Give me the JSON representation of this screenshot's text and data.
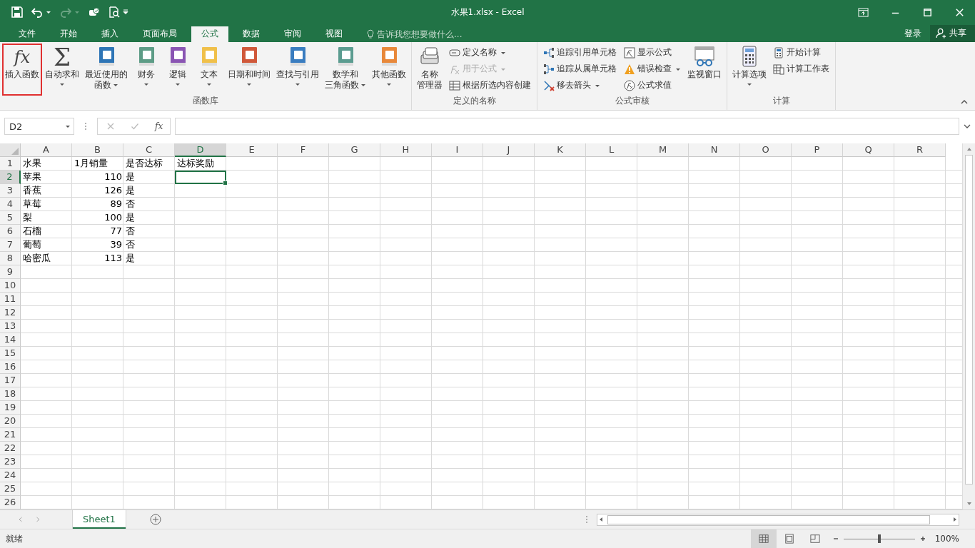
{
  "window": {
    "title": "水果1.xlsx - Excel"
  },
  "tabs": [
    {
      "label": "文件",
      "selected": false
    },
    {
      "label": "开始",
      "selected": false
    },
    {
      "label": "插入",
      "selected": false
    },
    {
      "label": "页面布局",
      "selected": false
    },
    {
      "label": "公式",
      "selected": true
    },
    {
      "label": "数据",
      "selected": false
    },
    {
      "label": "审阅",
      "selected": false
    },
    {
      "label": "视图",
      "selected": false
    }
  ],
  "tell_me": {
    "placeholder": "告诉我您想要做什么..."
  },
  "account": {
    "sign_in": "登录",
    "share": "共享"
  },
  "ribbon": [
    {
      "label": "函数库",
      "items": [
        {
          "kind": "large",
          "lines": [
            "插入函数"
          ],
          "glyph": "fx",
          "dropdown": false,
          "highlighted": true
        },
        {
          "kind": "large",
          "lines": [
            "自动求和"
          ],
          "glyph": "Σ",
          "dropdown": true
        },
        {
          "kind": "large",
          "lines": [
            "最近使用的",
            "函数"
          ],
          "dropdown": true
        },
        {
          "kind": "large",
          "lines": [
            "财务"
          ],
          "dropdown": true
        },
        {
          "kind": "large",
          "lines": [
            "逻辑"
          ],
          "dropdown": true
        },
        {
          "kind": "large",
          "lines": [
            "文本"
          ],
          "dropdown": true
        },
        {
          "kind": "large",
          "lines": [
            "日期和时间"
          ],
          "dropdown": true
        },
        {
          "kind": "large",
          "lines": [
            "查找与引用"
          ],
          "dropdown": true
        },
        {
          "kind": "large",
          "lines": [
            "数学和",
            "三角函数"
          ],
          "dropdown": true
        },
        {
          "kind": "large",
          "lines": [
            "其他函数"
          ],
          "dropdown": true
        }
      ]
    },
    {
      "label": "定义的名称",
      "items": [
        {
          "kind": "large",
          "lines": [
            "名称",
            "管理器"
          ],
          "dropdown": false
        },
        {
          "kind": "stack",
          "items": [
            {
              "label": "定义名称",
              "dropdown": true,
              "disabled": false
            },
            {
              "label": "用于公式",
              "dropdown": true,
              "disabled": true
            },
            {
              "label": "根据所选内容创建",
              "dropdown": false,
              "disabled": false
            }
          ]
        }
      ]
    },
    {
      "label": "公式审核",
      "items": [
        {
          "kind": "stack",
          "items": [
            {
              "label": "追踪引用单元格",
              "dropdown": false,
              "disabled": false
            },
            {
              "label": "追踪从属单元格",
              "dropdown": false,
              "disabled": false
            },
            {
              "label": "移去箭头",
              "dropdown": true,
              "disabled": false
            }
          ]
        },
        {
          "kind": "stack",
          "items": [
            {
              "label": "显示公式",
              "dropdown": false,
              "disabled": false
            },
            {
              "label": "错误检查",
              "dropdown": true,
              "disabled": false
            },
            {
              "label": "公式求值",
              "dropdown": false,
              "disabled": false
            }
          ]
        },
        {
          "kind": "large",
          "lines": [
            "监视窗口"
          ],
          "dropdown": false
        }
      ]
    },
    {
      "label": "计算",
      "items": [
        {
          "kind": "large",
          "lines": [
            "计算选项"
          ],
          "dropdown": true
        },
        {
          "kind": "stack",
          "items": [
            {
              "label": "开始计算",
              "dropdown": false,
              "disabled": false
            },
            {
              "label": "计算工作表",
              "dropdown": false,
              "disabled": false
            }
          ]
        }
      ]
    }
  ],
  "formula_bar": {
    "name_box": "D2",
    "fx": "fx"
  },
  "sheet": {
    "columns": [
      {
        "label": "A",
        "selected": false
      },
      {
        "label": "B",
        "selected": false
      },
      {
        "label": "C",
        "selected": false
      },
      {
        "label": "D",
        "selected": true
      },
      {
        "label": "E",
        "selected": false
      },
      {
        "label": "F",
        "selected": false
      },
      {
        "label": "G",
        "selected": false
      },
      {
        "label": "H",
        "selected": false
      },
      {
        "label": "I",
        "selected": false
      },
      {
        "label": "J",
        "selected": false
      },
      {
        "label": "K",
        "selected": false
      },
      {
        "label": "L",
        "selected": false
      },
      {
        "label": "M",
        "selected": false
      },
      {
        "label": "N",
        "selected": false
      },
      {
        "label": "O",
        "selected": false
      },
      {
        "label": "P",
        "selected": false
      },
      {
        "label": "Q",
        "selected": false
      },
      {
        "label": "R",
        "selected": false
      }
    ],
    "rows": [
      {
        "number": "1",
        "selected": false,
        "cells": [
          {
            "text": "水果",
            "kind": "text",
            "selected": false
          },
          {
            "text": "1月销量",
            "kind": "text",
            "selected": false
          },
          {
            "text": "是否达标",
            "kind": "text",
            "selected": false
          },
          {
            "text": "达标奖励",
            "kind": "text",
            "selected": false
          }
        ]
      },
      {
        "number": "2",
        "selected": true,
        "cells": [
          {
            "text": "苹果",
            "kind": "text",
            "selected": false
          },
          {
            "text": "110",
            "kind": "number",
            "selected": false
          },
          {
            "text": "是",
            "kind": "text",
            "selected": false
          },
          {
            "kind": "text",
            "selected": true
          }
        ]
      },
      {
        "number": "3",
        "selected": false,
        "cells": [
          {
            "text": "香蕉",
            "kind": "text",
            "selected": false
          },
          {
            "text": "126",
            "kind": "number",
            "selected": false
          },
          {
            "text": "是",
            "kind": "text",
            "selected": false
          }
        ]
      },
      {
        "number": "4",
        "selected": false,
        "cells": [
          {
            "text": "草莓",
            "kind": "text",
            "selected": false
          },
          {
            "text": "89",
            "kind": "number",
            "selected": false
          },
          {
            "text": "否",
            "kind": "text",
            "selected": false
          }
        ]
      },
      {
        "number": "5",
        "selected": false,
        "cells": [
          {
            "text": "梨",
            "kind": "text",
            "selected": false
          },
          {
            "text": "100",
            "kind": "number",
            "selected": false
          },
          {
            "text": "是",
            "kind": "text",
            "selected": false
          }
        ]
      },
      {
        "number": "6",
        "selected": false,
        "cells": [
          {
            "text": "石榴",
            "kind": "text",
            "selected": false
          },
          {
            "text": "77",
            "kind": "number",
            "selected": false
          },
          {
            "text": "否",
            "kind": "text",
            "selected": false
          }
        ]
      },
      {
        "number": "7",
        "selected": false,
        "cells": [
          {
            "text": "葡萄",
            "kind": "text",
            "selected": false
          },
          {
            "text": "39",
            "kind": "number",
            "selected": false
          },
          {
            "text": "否",
            "kind": "text",
            "selected": false
          }
        ]
      },
      {
        "number": "8",
        "selected": false,
        "cells": [
          {
            "text": "哈密瓜",
            "kind": "text",
            "selected": false
          },
          {
            "text": "113",
            "kind": "number",
            "selected": false
          },
          {
            "text": "是",
            "kind": "text",
            "selected": false
          }
        ]
      },
      {
        "number": "9",
        "selected": false
      },
      {
        "number": "10",
        "selected": false
      },
      {
        "number": "11",
        "selected": false
      },
      {
        "number": "12",
        "selected": false
      },
      {
        "number": "13",
        "selected": false
      },
      {
        "number": "14",
        "selected": false
      },
      {
        "number": "15",
        "selected": false
      },
      {
        "number": "16",
        "selected": false
      },
      {
        "number": "17",
        "selected": false
      },
      {
        "number": "18",
        "selected": false
      },
      {
        "number": "19",
        "selected": false
      },
      {
        "number": "20",
        "selected": false
      },
      {
        "number": "21",
        "selected": false
      },
      {
        "number": "22",
        "selected": false
      },
      {
        "number": "23",
        "selected": false
      },
      {
        "number": "24",
        "selected": false
      },
      {
        "number": "25",
        "selected": false
      },
      {
        "number": "26",
        "selected": false
      }
    ]
  },
  "sheet_tabs": [
    {
      "label": "Sheet1",
      "selected": true
    }
  ],
  "status_bar": {
    "status": "就绪",
    "views": [
      {
        "selected": true
      },
      {
        "selected": false
      },
      {
        "selected": false
      }
    ],
    "zoom": {
      "level": 0.5,
      "reading": "100%"
    }
  }
}
